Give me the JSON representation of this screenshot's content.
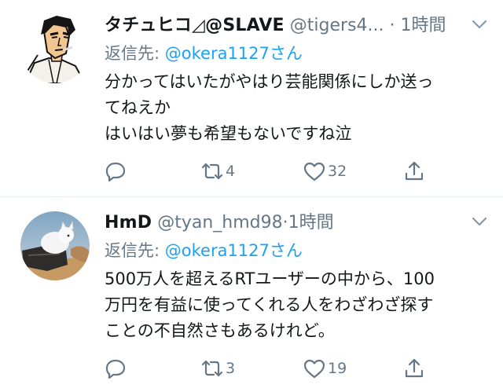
{
  "tweets": [
    {
      "name": "タチュヒコ◿@SLAVE",
      "handle": "@tigers4...",
      "separator": "·",
      "time": "1時間",
      "reply_prefix": "返信先: ",
      "reply_to": "@okera1127さん",
      "lines": [
        "分かってはいたがやはり芸能関係にしか送っ",
        "てねえか",
        "はいはい夢も希望もないですね泣"
      ],
      "retweets": "4",
      "likes": "32",
      "avatar": "anime-character-avatar"
    },
    {
      "name": "HmD",
      "handle": "@tyan_hmd98",
      "separator": "·",
      "time": "1時間",
      "reply_prefix": "返信先: ",
      "reply_to": "@okera1127さん",
      "lines": [
        "500万人を超えるRTユーザーの中から、100",
        "万円を有益に使ってくれる人をわざわざ探す",
        "ことの不自然さもあるけれど。"
      ],
      "retweets": "3",
      "likes": "19",
      "avatar": "cat-photo-avatar"
    }
  ],
  "icons": {
    "reply": "reply-icon",
    "retweet": "retweet-icon",
    "like": "heart-icon",
    "share": "share-icon",
    "more": "chevron-down-icon"
  },
  "colors": {
    "text": "#14171a",
    "muted": "#657786",
    "link": "#1da1f2",
    "divider": "#e6ecf0"
  }
}
